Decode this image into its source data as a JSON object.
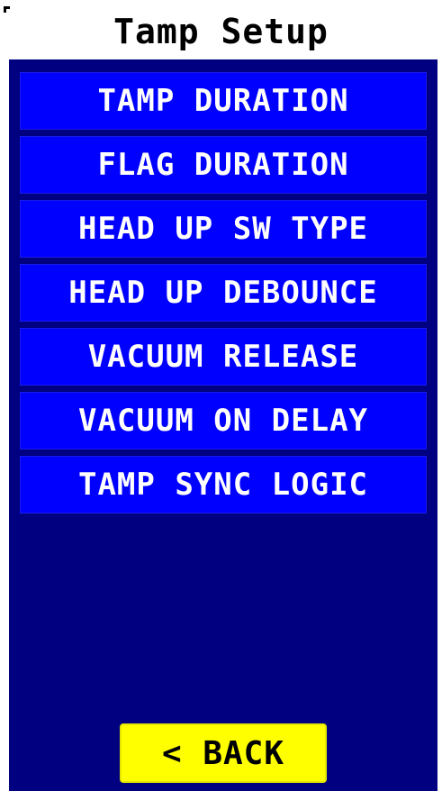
{
  "header": {
    "title": "Tamp Setup"
  },
  "menu": {
    "items": [
      {
        "label": "TAMP DURATION"
      },
      {
        "label": "FLAG DURATION"
      },
      {
        "label": "HEAD UP SW TYPE"
      },
      {
        "label": "HEAD UP DEBOUNCE"
      },
      {
        "label": "VACUUM RELEASE"
      },
      {
        "label": "VACUUM ON DELAY"
      },
      {
        "label": "TAMP SYNC LOGIC"
      }
    ]
  },
  "footer": {
    "back_label": "< BACK"
  },
  "colors": {
    "panel_background": "#000080",
    "menu_item_background": "#0000ff",
    "menu_item_text": "#ffffff",
    "back_button_background": "#ffff00",
    "back_button_text": "#000000",
    "title_background": "#ffffff",
    "title_text": "#000000"
  }
}
